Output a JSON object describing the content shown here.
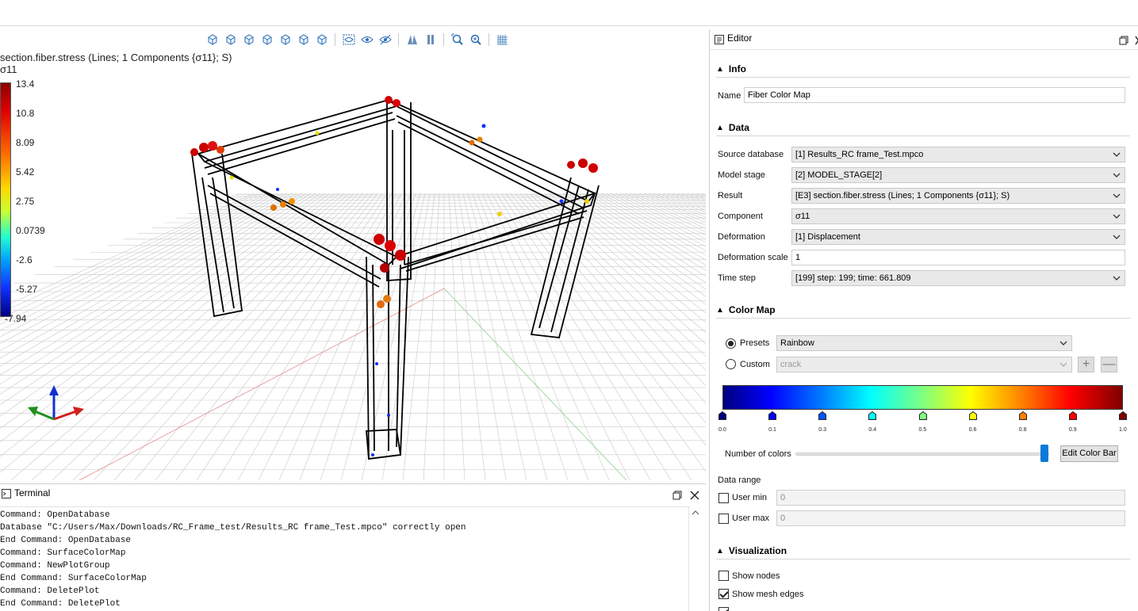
{
  "viewport": {
    "title": "section.fiber.stress (Lines; 1 Components {σ11}; S)",
    "component": "σ11",
    "colorbar_ticks": [
      "13.4",
      "10.8",
      "8.09",
      "5.42",
      "2.75",
      "0.0739",
      "-2.6",
      "-5.27",
      "-7.94"
    ],
    "toolbar_icons": [
      "view-iso-icon",
      "view-front-icon",
      "view-back-icon",
      "view-left-icon",
      "view-right-icon",
      "view-top-icon",
      "view-bottom-icon",
      "visibility-icon",
      "show-icon",
      "hide-icon",
      "perspective-icon",
      "parallel-icon",
      "zoom-fit-icon",
      "zoom-region-icon",
      "grid-icon"
    ]
  },
  "terminal": {
    "title": "Terminal",
    "lines": [
      "Command: OpenDatabase",
      "Database \"C:/Users/Max/Downloads/RC_Frame_test/Results_RC frame_Test.mpco\" correctly open",
      "End Command: OpenDatabase",
      "Command: SurfaceColorMap",
      "Command: NewPlotGroup",
      "End Command: SurfaceColorMap",
      "Command: DeletePlot",
      "End Command: DeletePlot"
    ]
  },
  "editor": {
    "title": "Editor",
    "info": {
      "header": "Info",
      "name_label": "Name",
      "name_value": "Fiber Color Map"
    },
    "data": {
      "header": "Data",
      "rows": [
        {
          "label": "Source database",
          "value": "[1] Results_RC frame_Test.mpco"
        },
        {
          "label": "Model stage",
          "value": "[2] MODEL_STAGE[2]"
        },
        {
          "label": "Result",
          "value": "[E3] section.fiber.stress (Lines; 1 Components {σ11}; S)"
        },
        {
          "label": "Component",
          "value": "σ11"
        },
        {
          "label": "Deformation",
          "value": "[1] Displacement"
        },
        {
          "label": "Deformation scale",
          "value": "1"
        },
        {
          "label": "Time step",
          "value": "[199] step: 199; time: 661.809"
        }
      ]
    },
    "colormap": {
      "header": "Color Map",
      "presets_label": "Presets",
      "presets_value": "Rainbow",
      "custom_label": "Custom",
      "custom_value": "crack",
      "stops": [
        "0.0",
        "0.1",
        "0.3",
        "0.4",
        "0.5",
        "0.6",
        "0.8",
        "0.9",
        "1.0"
      ],
      "stop_colors": [
        "#00007f",
        "#0000ff",
        "#0055ff",
        "#00ffff",
        "#7fff7f",
        "#ffff00",
        "#ff7f00",
        "#ff0000",
        "#7f0000"
      ],
      "num_colors_label": "Number of colors",
      "num_colors_fraction": 0.98,
      "edit_button": "Edit Color Bar",
      "data_range_label": "Data range",
      "user_min_label": "User min",
      "user_min_value": "0",
      "user_max_label": "User max",
      "user_max_value": "0"
    },
    "visualization": {
      "header": "Visualization",
      "show_nodes_label": "Show nodes",
      "show_nodes": false,
      "show_mesh_edges_label": "Show mesh edges",
      "show_mesh_edges": true
    }
  }
}
